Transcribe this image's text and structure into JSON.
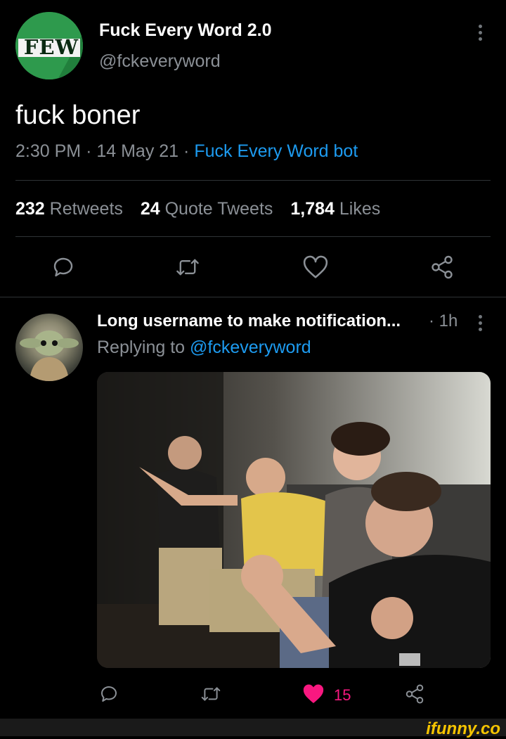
{
  "tweet": {
    "display_name": "Fuck Every Word 2.0",
    "handle": "@fckeveryword",
    "avatar_text": "FEW",
    "text": "fuck boner",
    "time": "2:30 PM",
    "date": "14 May 21",
    "source": "Fuck Every Word bot",
    "stats": {
      "retweets_count": "232",
      "retweets_label": "Retweets",
      "quotes_count": "24",
      "quotes_label": "Quote Tweets",
      "likes_count": "1,784",
      "likes_label": "Likes"
    }
  },
  "actions": [
    "reply-icon",
    "retweet-icon",
    "like-icon",
    "share-icon"
  ],
  "reply": {
    "display_name": "Long username to make notification...",
    "time": "· 1h",
    "replying_prefix": "Replying to",
    "replying_to": "@fckeveryword",
    "image_alt": "photo of men cheering and pointing",
    "likes": "15"
  },
  "footer": {
    "watermark": "ifunny.co"
  },
  "colors": {
    "background": "#000000",
    "accent": "#1d9bf0",
    "like": "#f91880",
    "muted": "#8b9096",
    "avatar_green": "#2e9a4d"
  }
}
